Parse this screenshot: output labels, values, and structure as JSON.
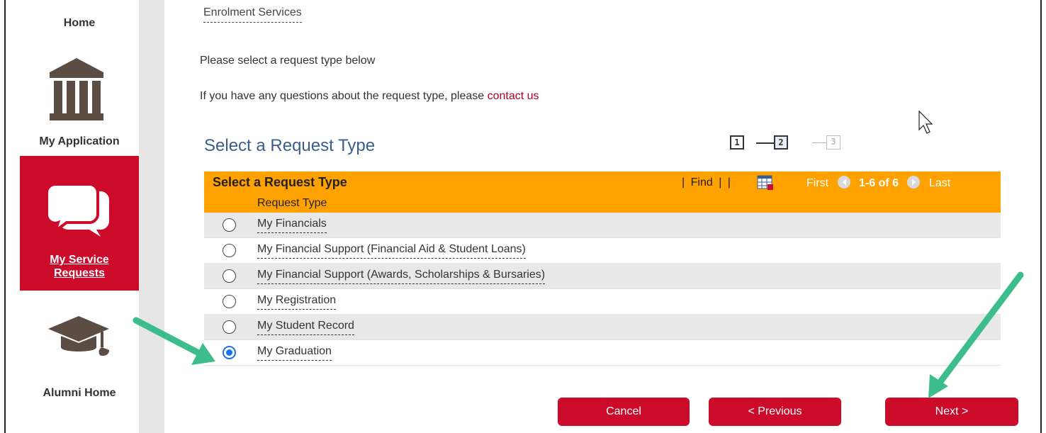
{
  "nav": {
    "home": "Home",
    "application": "My Application",
    "service_requests": "My Service\nRequests",
    "alumni": "Alumni Home"
  },
  "breadcrumb": "Enrolment Services",
  "intro": "Please select a request type below",
  "question": {
    "text": "If you have any questions about the request type, please ",
    "link": "contact us"
  },
  "page_title": "Select a Request Type",
  "steps": [
    "1",
    "2",
    "3"
  ],
  "grid": {
    "title": "Select a Request Type",
    "find": "Find",
    "first": "First",
    "count": "1-6 of 6",
    "last": "Last",
    "column": "Request Type",
    "rows": [
      {
        "label": "My Financials",
        "selected": false
      },
      {
        "label": "My Financial Support (Financial Aid & Student Loans)",
        "selected": false
      },
      {
        "label": "My Financial Support (Awards, Scholarships & Bursaries)",
        "selected": false
      },
      {
        "label": "My Registration",
        "selected": false
      },
      {
        "label": "My Student Record",
        "selected": false
      },
      {
        "label": "My Graduation",
        "selected": true
      }
    ]
  },
  "buttons": {
    "cancel": "Cancel",
    "previous": "< Previous",
    "next": "Next >"
  },
  "colors": {
    "brand_red": "#cc0a2a",
    "grid_orange": "#ffa200",
    "title_blue": "#3a5e8c",
    "annotation_green": "#3dbd8e"
  }
}
